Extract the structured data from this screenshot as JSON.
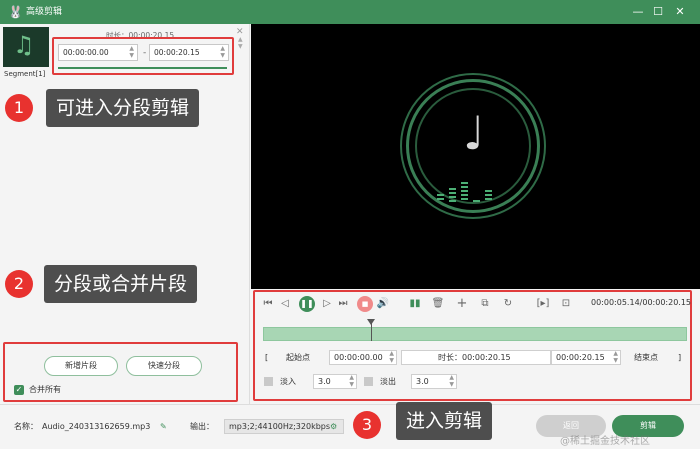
{
  "window": {
    "title": "高级剪辑",
    "controls": [
      "—",
      "☐",
      "✕"
    ]
  },
  "segment_panel": {
    "duration_label": "时长：00:00:20.15",
    "segment_label": "Segment[1]",
    "start_time": "00:00:00.00",
    "end_time": "00:00:20.15",
    "separator": "-"
  },
  "callouts": [
    {
      "number": "1",
      "text": "可进入分段剪辑"
    },
    {
      "number": "2",
      "text": "分段或合并片段"
    },
    {
      "number": "3",
      "text": "进入剪辑"
    }
  ],
  "segment_buttons": {
    "new_segment": "新增片段",
    "quick_split": "快速分段",
    "merge_all": "合并所有",
    "merge_all_checked": true
  },
  "player": {
    "timecode": "00:00:05.14/00:00:20.15",
    "playhead_fraction": 0.255,
    "start_label": "起始点",
    "start_value": "00:00:00.00",
    "duration_label": "时长：00:00:20.15",
    "end_value": "00:00:20.15",
    "end_label": "结束点",
    "fade_in_label": "淡入",
    "fade_in_value": "3.0",
    "fade_out_label": "淡出",
    "fade_out_value": "3.0"
  },
  "bottom": {
    "name_label": "名称：",
    "file_name": "Audio_240313162659.mp3",
    "output_label": "输出：",
    "output_format": "mp3;2;44100Hz;320kbps",
    "back_button": "返回",
    "edit_button": "剪辑"
  },
  "watermark": "@稀土掘金技术社区",
  "colors": {
    "accent": "#3f8e5a",
    "callout_red": "#e8322f",
    "highlight_border": "#e03c3c"
  }
}
